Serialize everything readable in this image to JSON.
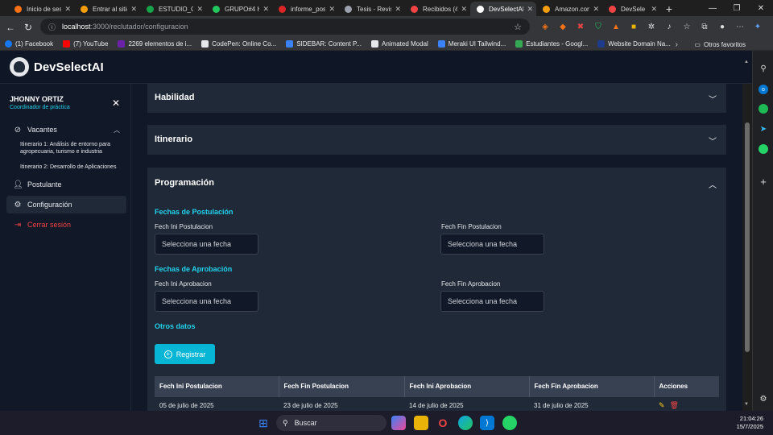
{
  "browser": {
    "tabs": [
      {
        "title": "Inicio de ses",
        "color": "#f97316"
      },
      {
        "title": "Entrar al sitio",
        "color": "#f59e0b"
      },
      {
        "title": "ESTUDIO_CA",
        "color": "#16a34a"
      },
      {
        "title": "GRUPO#4 H",
        "color": "#22c55e"
      },
      {
        "title": "informe_pos",
        "color": "#dc2626"
      },
      {
        "title": "Tesis - Revisi",
        "color": "#9ca3af"
      },
      {
        "title": "Recibidos (4",
        "color": "#ef4444"
      },
      {
        "title": "DevSelectAI",
        "color": "#ffffff"
      },
      {
        "title": "Amazon.com",
        "color": "#f59e0b"
      },
      {
        "title": "DevSele",
        "color": "#ef4444"
      }
    ],
    "url_host": "localhost",
    "url_path": ":3000/reclutador/configuracion",
    "bookmarks": [
      {
        "label": "(1) Facebook",
        "color": "#1877f2"
      },
      {
        "label": "(7) YouTube",
        "color": "#ff0000"
      },
      {
        "label": "2269 elementos de i...",
        "color": "#6b21a8"
      },
      {
        "label": "CodePen: Online Co...",
        "color": "#e5e7eb"
      },
      {
        "label": "SIDEBAR: Content P...",
        "color": "#3b82f6"
      },
      {
        "label": "Animated Modal",
        "color": "#e5e7eb"
      },
      {
        "label": "Meraki UI Tailwind...",
        "color": "#3b82f6"
      },
      {
        "label": "Estudiantes - Googl...",
        "color": "#34a853"
      },
      {
        "label": "Website Domain Na...",
        "color": "#1e3a8a"
      }
    ],
    "other_bookmarks": "Otros favoritos"
  },
  "app": {
    "brand": "DevSelectAI",
    "user": {
      "name": "JHONNY ORTIZ",
      "role": "Coordinador de práctica"
    },
    "sidebar": {
      "vacantes": "Vacantes",
      "sub1": "Itinerario 1: Análisis de entorno para agropecuaria, turismo e industria",
      "sub2": "Itinerario 2: Desarrollo de Aplicaciones",
      "postulante": "Postulante",
      "configuracion": "Configuración",
      "logout": "Cerrar sesión"
    },
    "accordion": {
      "habilidad": "Habilidad",
      "itinerario": "Itinerario",
      "programacion": "Programación"
    },
    "form": {
      "postulacion_heading": "Fechas de Postulación",
      "fech_ini_postulacion": "Fech Ini Postulacion",
      "fech_fin_postulacion": "Fech Fin Postulacion",
      "aprobacion_heading": "Fechas de Aprobación",
      "fech_ini_aprobacion": "Fech Ini Aprobacion",
      "fech_fin_aprobacion": "Fech Fin Aprobacion",
      "otros_heading": "Otros datos",
      "date_placeholder": "Selecciona una fecha",
      "register_label": "Registrar"
    },
    "table": {
      "headers": [
        "Fech Ini Postulacion",
        "Fech Fin Postulacion",
        "Fech Ini Aprobacion",
        "Fech Fin Aprobacion",
        "Acciones"
      ],
      "rows": [
        [
          "05 de julio de 2025",
          "23 de julio de 2025",
          "14 de julio de 2025",
          "31 de julio de 2025"
        ]
      ]
    }
  },
  "taskbar": {
    "search": "Buscar",
    "time": "21:04:26",
    "date": "15/7/2025"
  }
}
